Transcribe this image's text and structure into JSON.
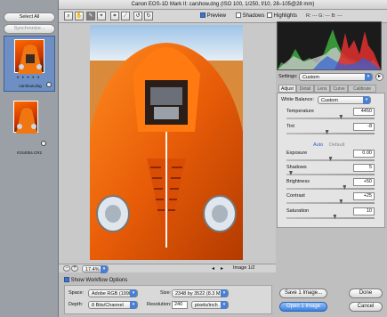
{
  "window": {
    "title": "Canon EOS-1D Mark II:  carshow.dng  (ISO 100, 1/250, f/10, 28–105@28 mm)"
  },
  "filmstrip": {
    "select_all": "Select All",
    "synchronize": "Synchronize...",
    "items": [
      {
        "filename": "carshow.dng",
        "selected": true
      },
      {
        "filename": "IGS4004.CR2",
        "selected": false
      }
    ]
  },
  "toolbar": {
    "tools": [
      "zoom-icon",
      "hand-icon",
      "white-balance-icon",
      "color-sampler-icon",
      "crop-icon",
      "straighten-icon",
      "rotate-left-icon",
      "rotate-right-icon"
    ],
    "preview_label": "Preview",
    "preview_checked": true,
    "shadows_label": "Shadows",
    "highlights_label": "Highlights",
    "r_label": "R:",
    "g_label": "G:",
    "b_label": "B:",
    "r_value": "---",
    "g_value": "---",
    "b_value": "---"
  },
  "bottombar": {
    "zoom": "17.4%",
    "image_counter": "Image 1/2"
  },
  "settings": {
    "label": "Settings:",
    "value": "Custom"
  },
  "tabs": [
    "Adjust",
    "Detail",
    "Lens",
    "Curve",
    "Calibrate"
  ],
  "adjust": {
    "white_balance_label": "White Balance:",
    "white_balance_value": "Custom",
    "temperature": {
      "label": "Temperature",
      "value": "4450",
      "position": 0.62
    },
    "tint": {
      "label": "Tint",
      "value": "-8",
      "position": 0.46
    },
    "auto_label": "Auto",
    "default_label": "Default",
    "exposure": {
      "label": "Exposure",
      "value": "0.00",
      "position": 0.5
    },
    "shadows": {
      "label": "Shadows",
      "value": "5",
      "position": 0.05
    },
    "brightness": {
      "label": "Brightness",
      "value": "+50",
      "position": 0.66
    },
    "contrast": {
      "label": "Contrast",
      "value": "+25",
      "position": 0.62
    },
    "saturation": {
      "label": "Saturation",
      "value": "10",
      "position": 0.55
    }
  },
  "workflow": {
    "show_label": "Show Workflow Options",
    "show_checked": true,
    "space_label": "Space:",
    "space_value": "Adobe RGB (1998)",
    "depth_label": "Depth:",
    "depth_value": "8 Bits/Channel",
    "size_label": "Size:",
    "size_value": "2348 by 3522  (8.3 MP)",
    "resolution_label": "Resolution:",
    "resolution_value": "240",
    "resolution_unit": "pixels/inch"
  },
  "buttons": {
    "save": "Save 1 Image...",
    "open": "Open 1 Image",
    "cancel": "Cancel",
    "done": "Done"
  },
  "colors": {
    "accent": "#3b7fe0",
    "car_orange": "#e46a12"
  }
}
